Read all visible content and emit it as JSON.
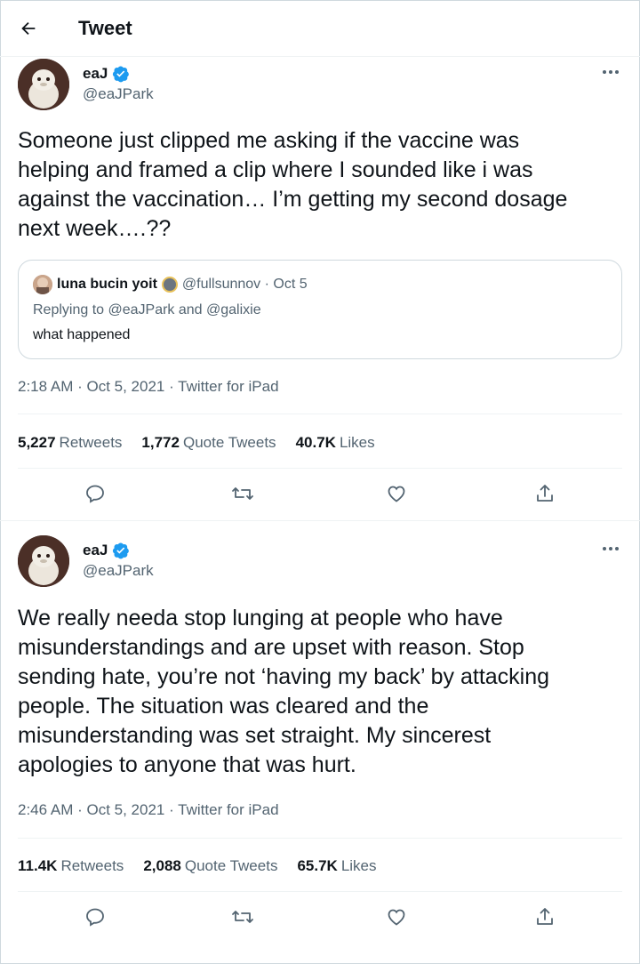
{
  "header": {
    "title": "Tweet"
  },
  "tweets": [
    {
      "name": "eaJ",
      "handle": "@eaJPark",
      "text": "Someone just clipped me asking if the vaccine was\nhelping and framed a clip where I sounded like i was\nagainst the vaccination… I’m getting my second dosage\nnext week….??",
      "quote": {
        "name": "luna bucin yoit",
        "handle_date": "@fullsunnov · Oct 5",
        "reply": "Replying to @eaJPark and @galixie",
        "text": "what happened"
      },
      "meta": "2:18 AM · Oct 5, 2021 · Twitter for iPad",
      "stats": {
        "retweets": "5,227",
        "retweets_label": "Retweets",
        "quotes": "1,772",
        "quotes_label": "Quote Tweets",
        "likes": "40.7K",
        "likes_label": "Likes"
      }
    },
    {
      "name": "eaJ",
      "handle": "@eaJPark",
      "text": "We really needa stop lunging at people who have\nmisunderstandings and are upset with reason. Stop\nsending hate, you’re not ‘having my back’ by attacking\npeople. The situation was cleared and the\nmisunderstanding was set straight. My sincerest\napologies to anyone that was hurt.",
      "meta": "2:46 AM · Oct 5, 2021 · Twitter for iPad",
      "stats": {
        "retweets": "11.4K",
        "retweets_label": "Retweets",
        "quotes": "2,088",
        "quotes_label": "Quote Tweets",
        "likes": "65.7K",
        "likes_label": "Likes"
      }
    }
  ],
  "icons": {
    "back": "arrow-left-icon",
    "verified": "verified-badge-icon",
    "more": "more-dots-icon",
    "reply": "reply-icon",
    "retweet": "retweet-icon",
    "like": "heart-icon",
    "share": "share-icon"
  },
  "colors": {
    "verified": "#1d9bf0",
    "secondary_text": "#536471",
    "border": "#cfd9de"
  }
}
